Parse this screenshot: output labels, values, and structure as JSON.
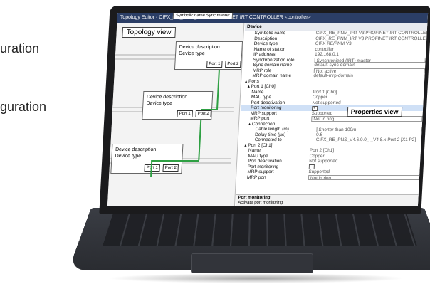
{
  "background_texts": [
    "uration",
    "guration"
  ],
  "window": {
    "title": "Topology Editor - CIFX_RE_PNM_IRT V3 PROFINET IRT CONTROLLER <controller>",
    "tooltip": "Symbolic name Sync master"
  },
  "topology": {
    "title": "Topology view",
    "devices": [
      {
        "name": "Device description",
        "type": "Device type",
        "port1": "Port 1",
        "port2": "Port 2"
      },
      {
        "name": "Device description",
        "type": "Device type",
        "port1": "Port 1",
        "port2": "Port 2"
      },
      {
        "name": "Device description",
        "type": "Device type",
        "port1": "Port 1",
        "port2": "Port 2"
      }
    ]
  },
  "properties": {
    "label": "Properties view",
    "section": "Device",
    "rows": [
      {
        "key": "Symbolic name",
        "value": "CIFX_RE_PNM_IRT V3 PROFINET IRT CONTROLLER"
      },
      {
        "key": "Description",
        "value": "CIFX_RE_PNM_IRT V3 PROFINET IRT CONTROLLER"
      },
      {
        "key": "Device type",
        "value": "CIFX RE/PNM V3"
      },
      {
        "key": "Name of station",
        "value": "controller"
      },
      {
        "key": "IP address",
        "value": "192.168.0.1"
      },
      {
        "key": "Synchronization role",
        "value": "Synchronized (IRT) master"
      },
      {
        "key": "Sync domain name",
        "value": "default-sync-domain"
      },
      {
        "key": "MRP role",
        "value": "Not active"
      },
      {
        "key": "MRP domain name",
        "value": "default-mrp-domain"
      },
      {
        "key": "▴ Ports",
        "value": ""
      },
      {
        "key": "▴ Port 1 [Ch0]",
        "value": ""
      },
      {
        "key": "Name",
        "value": "Port 1 [Ch0]"
      },
      {
        "key": "MAU type",
        "value": "Copper"
      },
      {
        "key": "Port deactivation",
        "value": "Not supported"
      },
      {
        "key": "Port monitoring",
        "value": "✔"
      },
      {
        "key": "MRP support",
        "value": "Supported"
      },
      {
        "key": "MRP port",
        "value": "Not in ring"
      },
      {
        "key": "▴ Connection",
        "value": ""
      },
      {
        "key": "Cable length (m)",
        "value": "Shorter than 100m"
      },
      {
        "key": "Delay time (µs)",
        "value": "0.6"
      },
      {
        "key": "Connected to",
        "value": "CIFX_RE_PNS_V4.6.0.0_-_V4.8.x-Port 2 [X1 P2]"
      },
      {
        "key": "▴ Port 2 [Ch1]",
        "value": ""
      },
      {
        "key": "Name",
        "value": "Port 2 [Ch1]"
      },
      {
        "key": "MAU type",
        "value": "Copper"
      },
      {
        "key": "Port deactivation",
        "value": "Not supported"
      },
      {
        "key": "Port monitoring",
        "value": ""
      },
      {
        "key": "MRP support",
        "value": "Supported"
      },
      {
        "key": "MRP port",
        "value": "Not in ring"
      }
    ],
    "status_title": "Port monitoring",
    "status_text": "Activate port monitoring"
  }
}
